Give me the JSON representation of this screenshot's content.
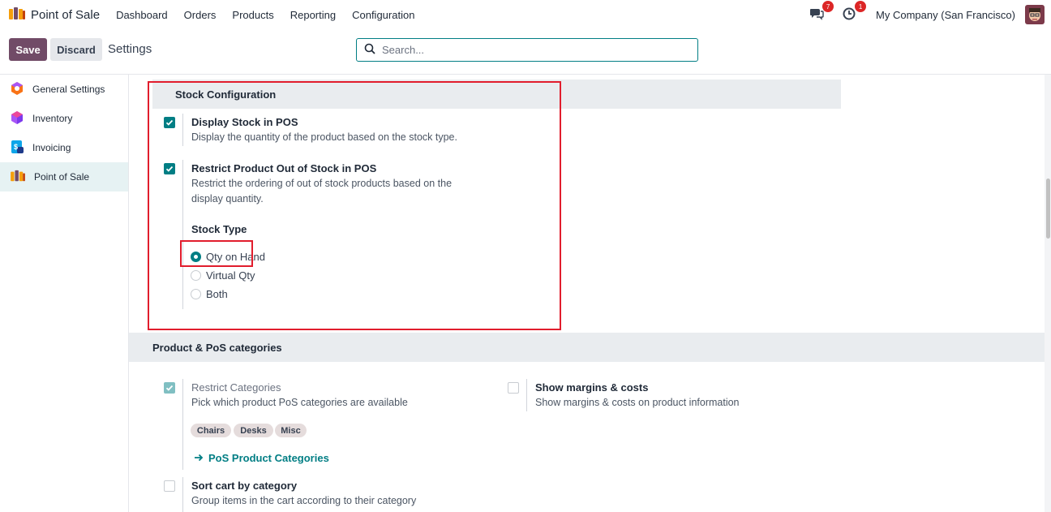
{
  "navbar": {
    "app_name": "Point of Sale",
    "menu": [
      "Dashboard",
      "Orders",
      "Products",
      "Reporting",
      "Configuration"
    ],
    "messages_count": "7",
    "activities_count": "1",
    "company": "My Company (San Francisco)"
  },
  "control": {
    "save_label": "Save",
    "discard_label": "Discard",
    "breadcrumb": "Settings",
    "search_placeholder": "Search..."
  },
  "sidebar": {
    "items": [
      {
        "label": "General Settings",
        "icon": "gear-hexagon-icon"
      },
      {
        "label": "Inventory",
        "icon": "cube-icon"
      },
      {
        "label": "Invoicing",
        "icon": "invoice-icon"
      },
      {
        "label": "Point of Sale",
        "icon": "pos-shop-icon",
        "active": true
      }
    ]
  },
  "stock": {
    "heading": "Stock Configuration",
    "display_stock": {
      "title": "Display Stock in POS",
      "desc": "Display the quantity of the product based on the stock type.",
      "checked": true
    },
    "restrict": {
      "title": "Restrict Product Out of Stock in POS",
      "desc1": "Restrict the ordering of out of stock products based on the",
      "desc2": "display quantity.",
      "checked": true
    },
    "stock_type": {
      "label": "Stock Type",
      "options": [
        "Qty on Hand",
        "Virtual Qty",
        "Both"
      ],
      "selected": "Qty on Hand"
    }
  },
  "categories": {
    "heading": "Product & PoS categories",
    "restrict_categories": {
      "title": "Restrict Categories",
      "desc": "Pick which product PoS categories are available",
      "checked": true,
      "tags": [
        "Chairs",
        "Desks",
        "Misc"
      ],
      "link": "PoS Product Categories"
    },
    "show_margins": {
      "title": "Show margins & costs",
      "desc": "Show margins & costs on product information",
      "checked": false
    },
    "sort_cart": {
      "title": "Sort cart by category",
      "desc": "Group items in the cart according to their category",
      "checked": false
    }
  },
  "colors": {
    "brand": "#714b67",
    "accent": "#017e84",
    "highlight_box": "#e11d2d",
    "badge": "#dc2626"
  }
}
